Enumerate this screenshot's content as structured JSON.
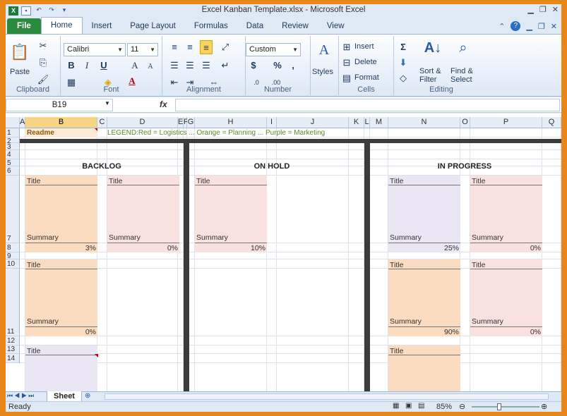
{
  "window": {
    "title": "Excel Kanban Template.xlsx  -  Microsoft Excel"
  },
  "tabs": [
    "File",
    "Home",
    "Insert",
    "Page Layout",
    "Formulas",
    "Data",
    "Review",
    "View"
  ],
  "ribbon": {
    "clipboard": {
      "paste": "Paste",
      "label": "Clipboard"
    },
    "font": {
      "name": "Calibri",
      "size": "11",
      "bold": "B",
      "italic": "I",
      "underline": "U",
      "grow": "A",
      "shrink": "A",
      "label": "Font"
    },
    "alignment": {
      "label": "Alignment"
    },
    "number": {
      "format": "Custom",
      "currency": "$",
      "percent": "%",
      "comma": ",",
      "label": "Number"
    },
    "styles": {
      "styles": "Styles"
    },
    "cells": {
      "insert": "Insert",
      "delete": "Delete",
      "format": "Format",
      "label": "Cells"
    },
    "editing": {
      "sort": "Sort &",
      "sort2": "Filter",
      "find": "Find &",
      "find2": "Select",
      "label": "Editing"
    }
  },
  "formula_bar": {
    "name_box": "B19",
    "fx": "fx",
    "value": ""
  },
  "columns": [
    "A",
    "B",
    "C",
    "D",
    "E",
    "F",
    "G",
    "H",
    "I",
    "J",
    "K",
    "L",
    "M",
    "N",
    "O",
    "P",
    "Q"
  ],
  "rows": [
    "1",
    "2",
    "3",
    "4",
    "5",
    "6",
    "7",
    "8",
    "9",
    "10",
    "11",
    "12",
    "13",
    "14"
  ],
  "sheet": {
    "readme": "Readme",
    "legend": "LEGEND:Red = Logistics ... Orange = Planning ... Purple = Marketing",
    "backlog": "BACKLOG",
    "on_hold": "ON HOLD",
    "in_progress": "IN PROGRESS",
    "title": "Title",
    "summary": "Summary",
    "cards": [
      {
        "pct": "3%",
        "color": "#fbdcc0"
      },
      {
        "pct": "0%",
        "color": "#f9e1df"
      },
      {
        "pct": "10%",
        "color": "#f9e1df"
      },
      {
        "pct": "25%",
        "color": "#ebe6f3"
      },
      {
        "pct": "0%",
        "color": "#f9e1df"
      },
      {
        "pct": "0%",
        "color": "#fbdcc0"
      },
      {
        "pct": "90%",
        "color": "#fbdcc0"
      },
      {
        "pct": "0%",
        "color": "#f9e1df"
      },
      {
        "pct": "",
        "color": "#ebe6f3"
      },
      {
        "pct": "",
        "color": "#fbdcc0"
      }
    ]
  },
  "sheet_tabs": [
    "Sheet"
  ],
  "status": {
    "ready": "Ready",
    "zoom": "85%"
  }
}
